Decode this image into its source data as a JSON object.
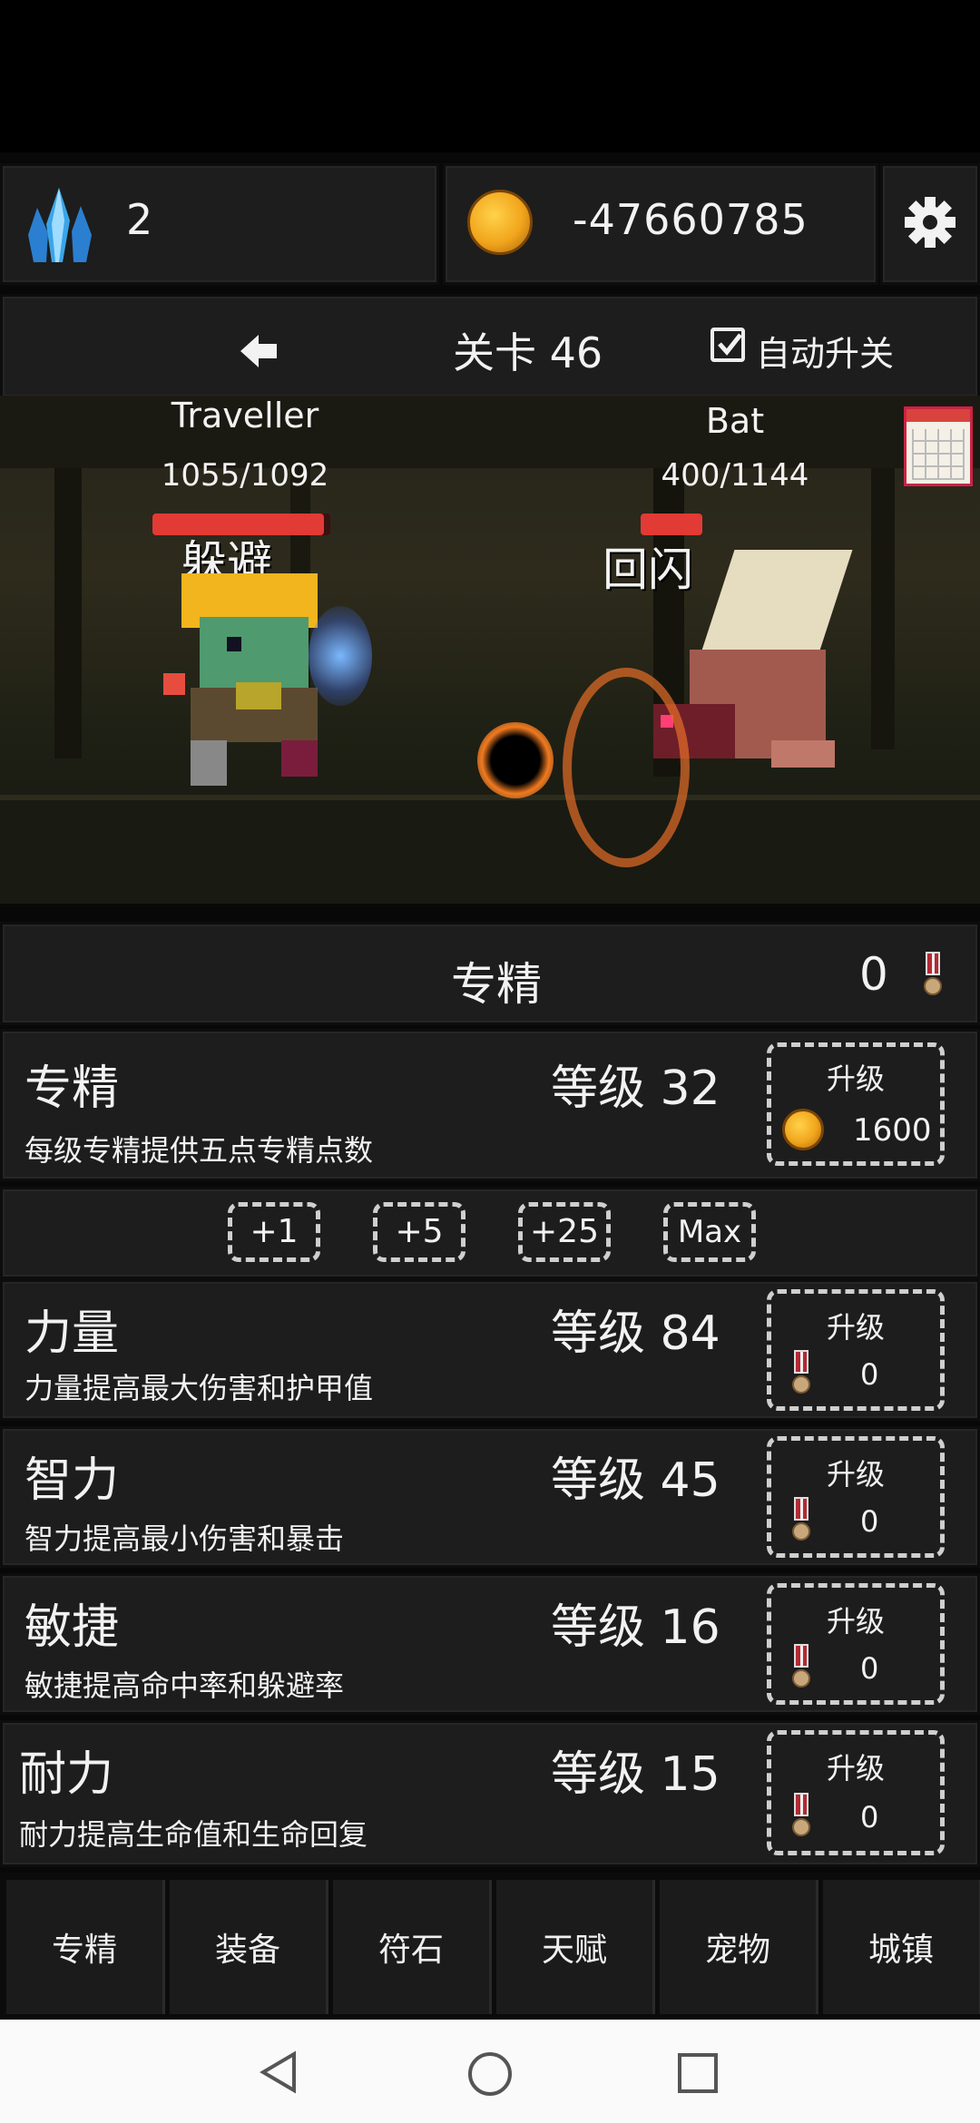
{
  "header": {
    "crystals": "2",
    "gold": "-47660785"
  },
  "stage": {
    "label": "关卡 46",
    "auto_label": "自动升关",
    "auto_checked": true
  },
  "battle": {
    "player": {
      "name": "Traveller",
      "hp": "1055/1092",
      "hp_fraction": 0.966,
      "status": "躲避"
    },
    "enemy": {
      "name": "Bat",
      "hp": "400/1144",
      "hp_fraction": 0.35,
      "status": "回闪"
    }
  },
  "mastery_header": {
    "title": "专精",
    "points": "0"
  },
  "mastery": {
    "name": "专精",
    "level": "等级 32",
    "desc": "每级专精提供五点专精点数",
    "upgrade_label": "升级",
    "cost": "1600"
  },
  "multipliers": [
    "+1",
    "+5",
    "+25",
    "Max"
  ],
  "stats": [
    {
      "name": "力量",
      "level": "等级 84",
      "desc": "力量提高最大伤害和护甲值",
      "upgrade_label": "升级",
      "cost": "0"
    },
    {
      "name": "智力",
      "level": "等级 45",
      "desc": "智力提高最小伤害和暴击",
      "upgrade_label": "升级",
      "cost": "0"
    },
    {
      "name": "敏捷",
      "level": "等级 16",
      "desc": "敏捷提高命中率和躲避率",
      "upgrade_label": "升级",
      "cost": "0"
    },
    {
      "name": "耐力",
      "level": "等级 15",
      "desc": "耐力提高生命值和生命回复",
      "upgrade_label": "升级",
      "cost": "0"
    }
  ],
  "nav": [
    "专精",
    "装备",
    "符石",
    "天赋",
    "宠物",
    "城镇"
  ],
  "icons": {
    "crystal": "crystal-icon",
    "gold": "gold-coin-icon",
    "settings": "gear-icon",
    "back": "back-arrow-icon",
    "calendar": "calendar-icon",
    "medal": "medal-icon"
  },
  "colors": {
    "hp_bar": "#e23a35",
    "panel": "#1d1d1d",
    "background": "#080808"
  }
}
